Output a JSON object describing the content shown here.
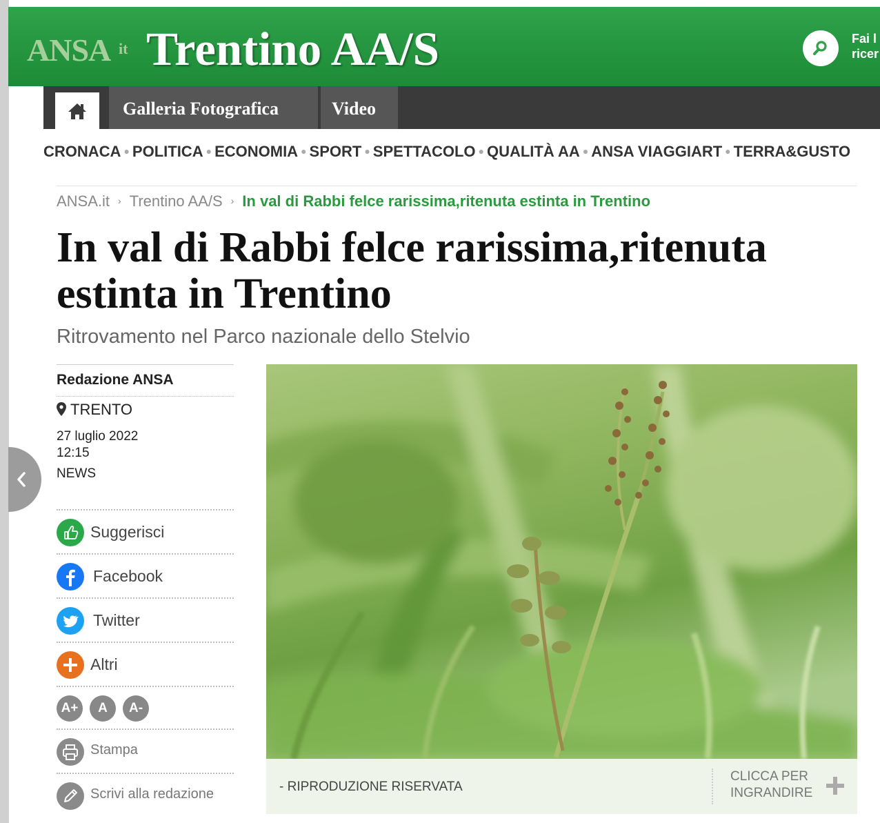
{
  "header": {
    "logo_text": "ANSA",
    "logo_suffix": "it",
    "site_title": "Trentino AA/S",
    "search_label": "Fai la ricerca",
    "search_label_line1": "Fai l",
    "search_label_line2": "ricer",
    "brand_color": "#22933d",
    "search_icon": "search-icon"
  },
  "nav": {
    "home_icon": "home-icon",
    "tabs": [
      {
        "label": "Galleria Fotografica"
      },
      {
        "label": "Video"
      }
    ]
  },
  "sections": [
    "CRONACA",
    "POLITICA",
    "ECONOMIA",
    "SPORT",
    "SPETTACOLO",
    "QUALITÀ AA",
    "ANSA VIAGGIART",
    "TERRA&GUSTO"
  ],
  "breadcrumb": {
    "items": [
      "ANSA.it",
      "Trentino AA/S"
    ],
    "current": "In val di Rabbi felce rarissima,ritenuta estinta in Trentino"
  },
  "article": {
    "headline": "In val di Rabbi felce rarissima,ritenuta estinta in Trentino",
    "subtitle": "Ritrovamento nel Parco nazionale dello Stelvio",
    "author": "Redazione ANSA",
    "place": "TRENTO",
    "date": "27 luglio 2022",
    "time": "12:15",
    "kind": "NEWS"
  },
  "actions": {
    "suggest": "Suggerisci",
    "facebook": "Facebook",
    "twitter": "Twitter",
    "others": "Altri",
    "font_increase": "A+",
    "font_reset": "A",
    "font_decrease": "A-",
    "print": "Stampa",
    "write": "Scrivi alla redazione"
  },
  "image": {
    "caption": "- RIPRODUZIONE RISERVATA",
    "enlarge_line1": "CLICCA PER",
    "enlarge_line2": "INGRANDIRE"
  }
}
